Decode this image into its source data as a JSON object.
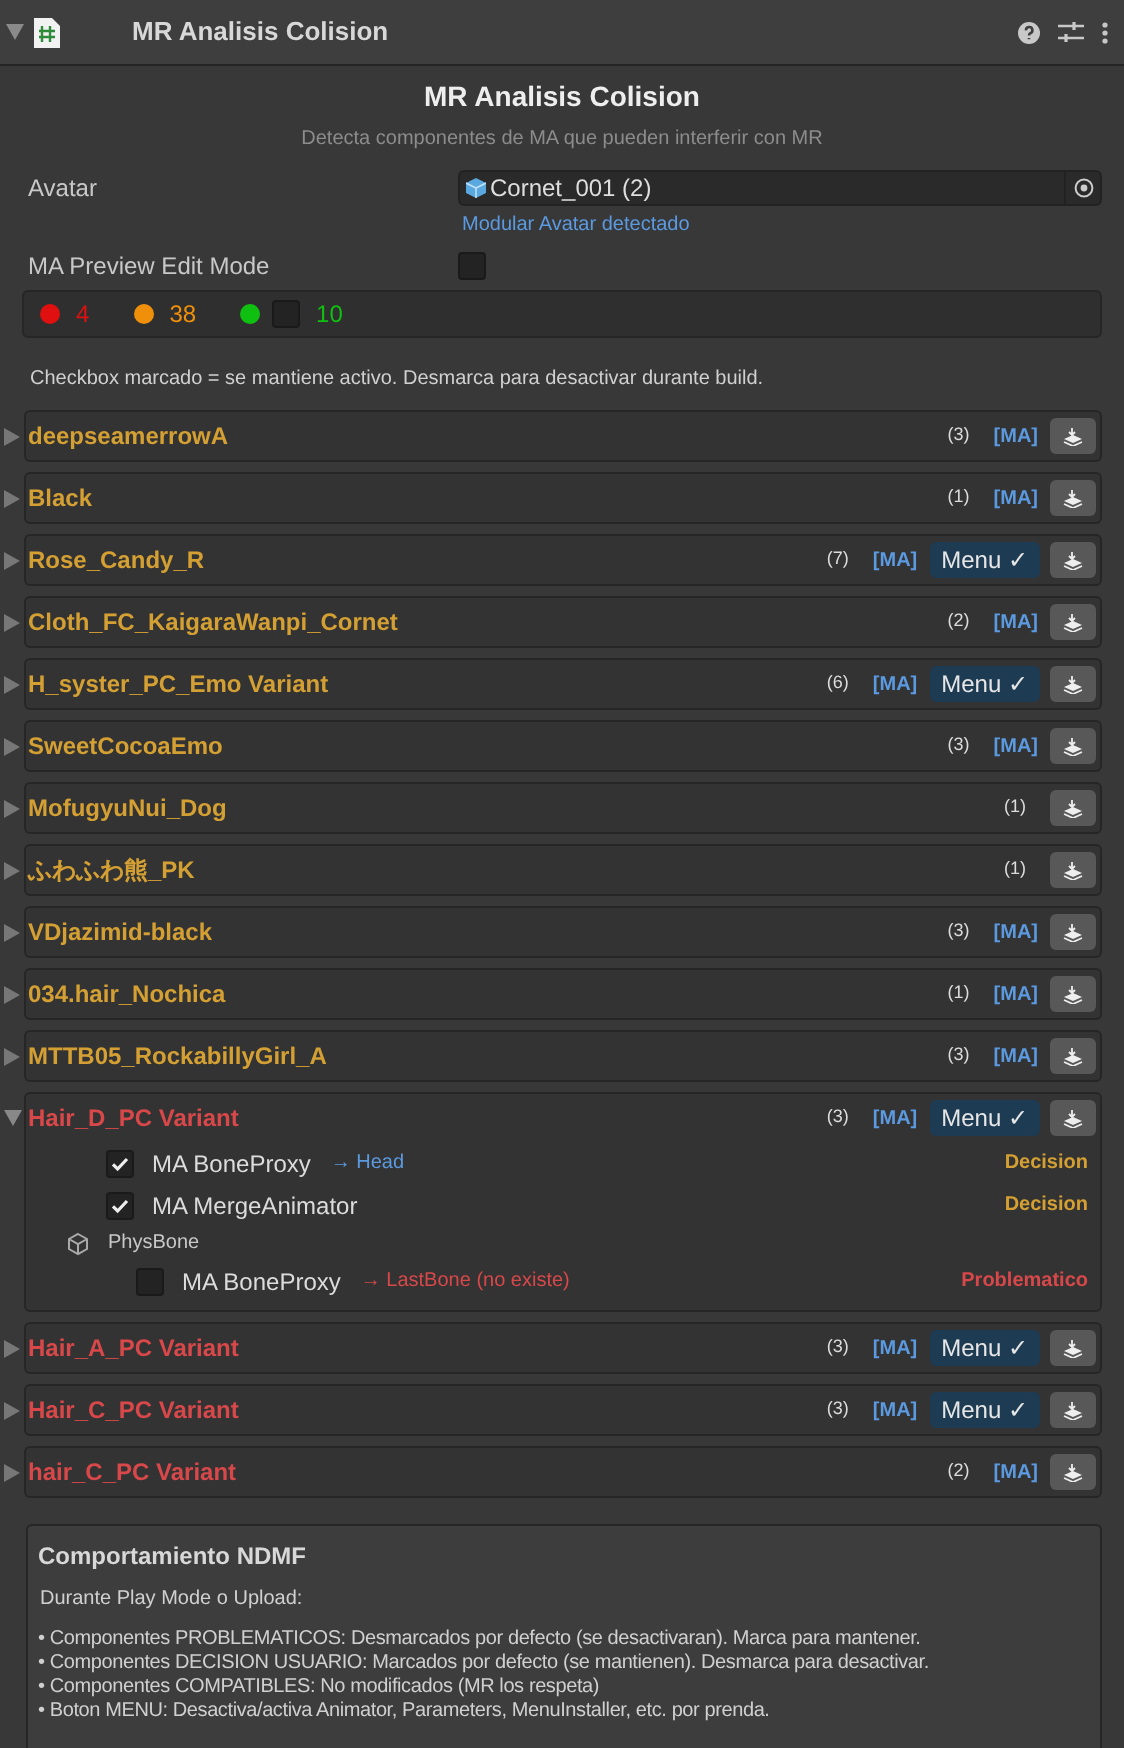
{
  "header": {
    "title": "MR Analisis Colision"
  },
  "title": "MR Analisis Colision",
  "subtitle": "Detecta componentes de MA que pueden interferir con MR",
  "avatar": {
    "label": "Avatar",
    "value": "Cornet_001 (2)",
    "note": "Modular Avatar detectado"
  },
  "preview": {
    "label": "MA Preview Edit Mode",
    "checked": false
  },
  "counts": [
    {
      "color": "#e01010",
      "value": "4"
    },
    {
      "color": "#f0900a",
      "value": "38"
    },
    {
      "color": "#10c010",
      "value": "10",
      "checkbox": true,
      "checked": false
    }
  ],
  "hint": "Checkbox marcado = se mantiene activo. Desmarca para desactivar durante build.",
  "groups": [
    {
      "name": "deepseamerrowA",
      "color": "#d4a033",
      "count": "(3)",
      "ma": "[MA]",
      "expanded": false
    },
    {
      "name": "Black",
      "color": "#d4a033",
      "count": "(1)",
      "ma": "[MA]",
      "expanded": false
    },
    {
      "name": "Rose_Candy_R",
      "color": "#d4a033",
      "count": "(7)",
      "ma": "[MA]",
      "menu": "Menu ✓",
      "expanded": false
    },
    {
      "name": "Cloth_FC_KaigaraWanpi_Cornet",
      "color": "#d4a033",
      "count": "(2)",
      "ma": "[MA]",
      "expanded": false
    },
    {
      "name": "H_syster_PC_Emo Variant",
      "color": "#d4a033",
      "count": "(6)",
      "ma": "[MA]",
      "menu": "Menu ✓",
      "expanded": false
    },
    {
      "name": "SweetCocoaEmo",
      "color": "#d4a033",
      "count": "(3)",
      "ma": "[MA]",
      "expanded": false
    },
    {
      "name": "MofugyuNui_Dog",
      "color": "#d4a033",
      "count": "(1)",
      "expanded": false
    },
    {
      "name": "ふわふわ熊_PK",
      "color": "#d4a033",
      "count": "(1)",
      "expanded": false
    },
    {
      "name": "VDjazimid-black",
      "color": "#d4a033",
      "count": "(3)",
      "ma": "[MA]",
      "expanded": false
    },
    {
      "name": "034.hair_Nochica",
      "color": "#d4a033",
      "count": "(1)",
      "ma": "[MA]",
      "expanded": false
    },
    {
      "name": "MTTB05_RockabillyGirl_A",
      "color": "#d4a033",
      "count": "(3)",
      "ma": "[MA]",
      "expanded": false
    },
    {
      "name": "Hair_D_PC Variant",
      "color": "#d8484a",
      "count": "(3)",
      "ma": "[MA]",
      "menu": "Menu ✓",
      "expanded": true,
      "children": [
        {
          "kind": "component",
          "name": "MA BoneProxy",
          "target": {
            "text": "→ Head",
            "color": "#5b9ae0"
          },
          "verdict": "Decision",
          "color": "#d4a033",
          "checked": true
        },
        {
          "kind": "component",
          "name": "MA MergeAnimator",
          "verdict": "Decision",
          "color": "#d4a033",
          "checked": true
        },
        {
          "kind": "section",
          "name": "PhysBone",
          "children": [
            {
              "kind": "component",
              "name": "MA BoneProxy",
              "target": {
                "text": "→ LastBone (no existe)",
                "color": "#d8484a"
              },
              "verdict": "Problematico",
              "color": "#d8484a",
              "checked": false
            }
          ]
        }
      ]
    },
    {
      "name": "Hair_A_PC Variant",
      "color": "#d8484a",
      "count": "(3)",
      "ma": "[MA]",
      "menu": "Menu ✓",
      "expanded": false
    },
    {
      "name": "Hair_C_PC Variant",
      "color": "#d8484a",
      "count": "(3)",
      "ma": "[MA]",
      "menu": "Menu ✓",
      "expanded": false
    },
    {
      "name": "hair_C_PC Variant",
      "color": "#d8484a",
      "count": "(2)",
      "ma": "[MA]",
      "expanded": false
    }
  ],
  "info": {
    "title": "Comportamiento NDMF",
    "intro": "Durante Play Mode o Upload:",
    "bullets": [
      "• Componentes PROBLEMATICOS: Desmarcados por defecto (se desactivaran). Marca para mantener.",
      "• Componentes DECISION USUARIO: Marcados por defecto (se mantienen). Desmarca para desactivar.",
      "• Componentes COMPATIBLES: No modificados (MR los respeta)",
      "• Boton MENU: Desactiva/activa Animator, Parameters, MenuInstaller, etc. por prenda."
    ]
  }
}
